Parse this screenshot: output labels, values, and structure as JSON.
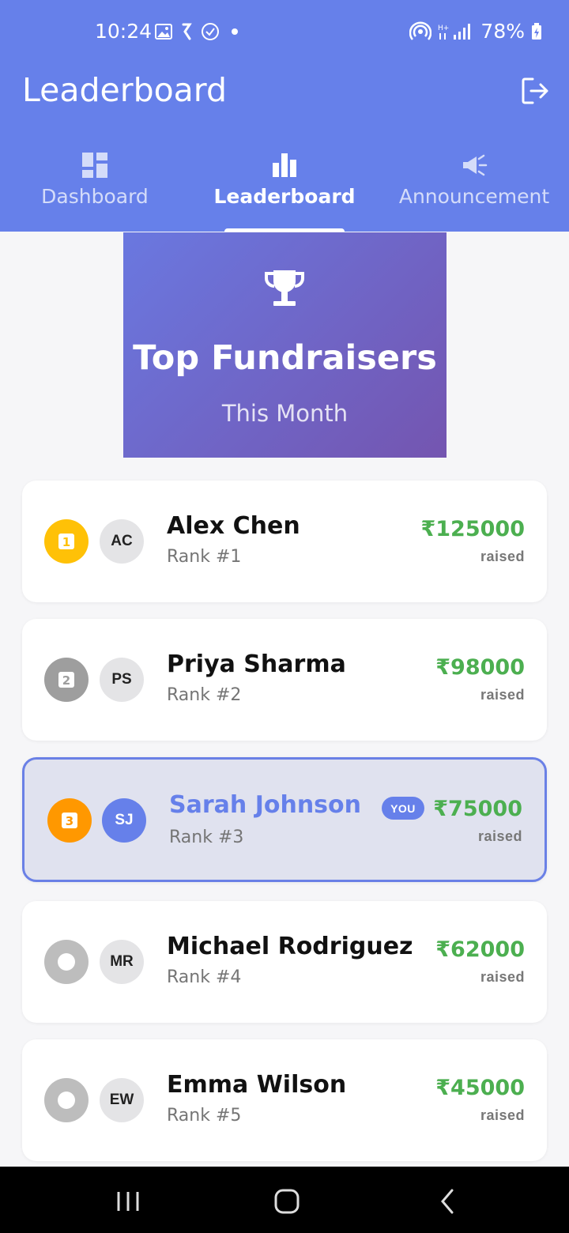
{
  "status_bar": {
    "time": "10:24",
    "battery": "78%"
  },
  "app_bar": {
    "title": "Leaderboard"
  },
  "tabs": [
    {
      "label": "Dashboard",
      "icon": "dashboard-icon",
      "active": false
    },
    {
      "label": "Leaderboard",
      "icon": "bar-chart-icon",
      "active": true
    },
    {
      "label": "Announcement",
      "icon": "megaphone-icon",
      "active": false
    }
  ],
  "banner": {
    "title": "Top Fundraisers",
    "subtitle": "This Month"
  },
  "leaderboard": [
    {
      "name": "Alex Chen",
      "initials": "AC",
      "rank_label": "Rank #1",
      "medal_number": "1",
      "amount": "₹125000",
      "raised_label": "raised",
      "medal_color": "#ffc107"
    },
    {
      "name": "Priya Sharma",
      "initials": "PS",
      "rank_label": "Rank #2",
      "medal_number": "2",
      "amount": "₹98000",
      "raised_label": "raised",
      "medal_color": "#9e9e9e"
    },
    {
      "name": "Sarah Johnson",
      "initials": "SJ",
      "rank_label": "Rank #3",
      "medal_number": "3",
      "amount": "₹75000",
      "raised_label": "raised",
      "medal_color": "#ff9800",
      "you_label": "YOU"
    },
    {
      "name": "Michael Rodriguez",
      "initials": "MR",
      "rank_label": "Rank #4",
      "amount": "₹62000",
      "raised_label": "raised",
      "medal_color": "#bdbdbd"
    },
    {
      "name": "Emma Wilson",
      "initials": "EW",
      "rank_label": "Rank #5",
      "amount": "₹45000",
      "raised_label": "raised",
      "medal_color": "#bdbdbd"
    }
  ],
  "colors": {
    "primary": "#6680ea",
    "amount_green": "#4caf50",
    "gold": "#ffc107",
    "silver": "#9e9e9e",
    "bronze": "#ff9800"
  }
}
